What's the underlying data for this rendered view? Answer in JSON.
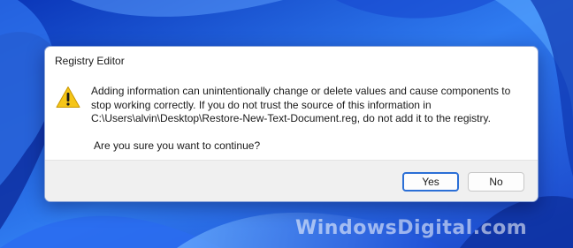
{
  "dialog": {
    "title": "Registry Editor",
    "message": "Adding information can unintentionally change or delete values and cause components to stop working correctly. If you do not trust the source of this information in C:\\Users\\alvin\\Desktop\\Restore-New-Text-Document.reg, do not add it to the registry.",
    "question": "Are you sure you want to continue?",
    "icon": "warning-icon",
    "buttons": {
      "yes": "Yes",
      "no": "No"
    }
  },
  "watermark": "WindowsDigital.com",
  "colors": {
    "accent": "#2b6fd6",
    "warning": "#f5c518",
    "wallpaper": "#1f5ee8"
  }
}
